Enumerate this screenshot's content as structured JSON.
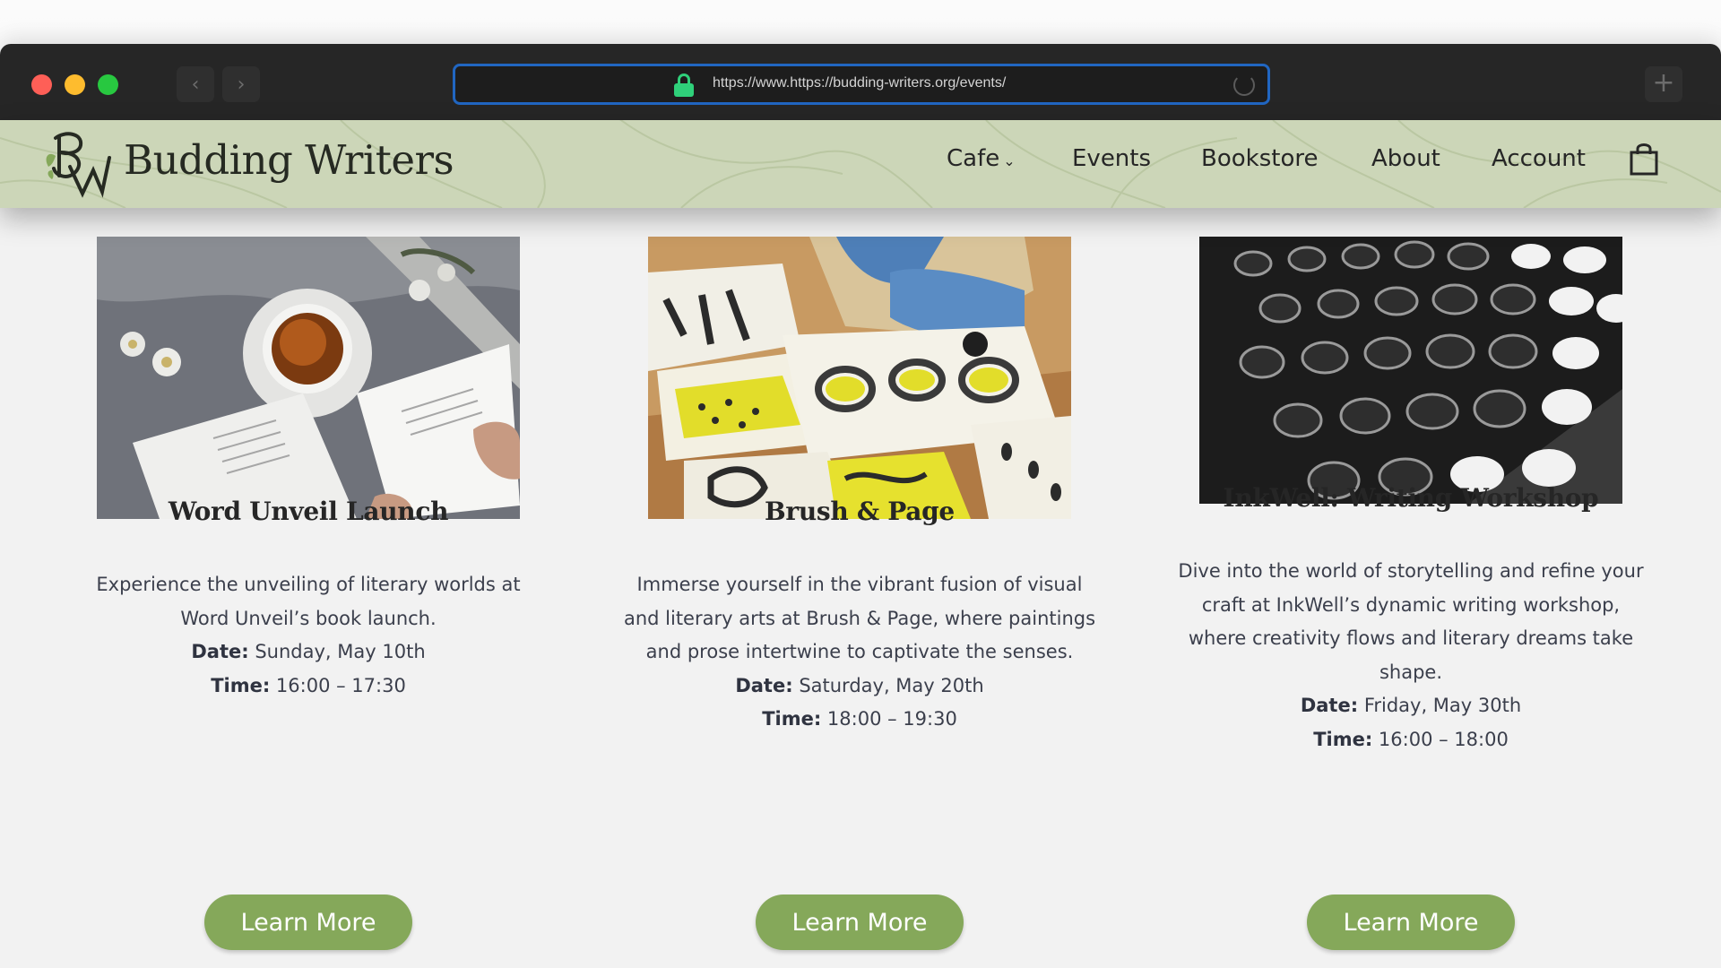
{
  "browser": {
    "url": "https://www.https://budding-writers.org/events/",
    "back_icon": "‹",
    "forward_icon": "›",
    "new_tab_icon": "+"
  },
  "site": {
    "title": "Budding Writers",
    "nav": [
      {
        "label": "Cafe",
        "has_dropdown": true
      },
      {
        "label": "Events"
      },
      {
        "label": "Bookstore"
      },
      {
        "label": "About"
      },
      {
        "label": "Account"
      }
    ],
    "dropdown_chevron": "⌄",
    "header_color": "#ccd6b8",
    "accent_color": "#85a85a"
  },
  "events": [
    {
      "title": "Word Unveil Launch",
      "description": "Experience the unveiling of literary worlds at Word Unveil’s book launch.",
      "date_label": "Date:",
      "date": "Sunday, May 10th",
      "time_label": "Time:",
      "time": "16:00 – 17:30",
      "button": "Learn More",
      "image_icon": "tea-and-book-photo"
    },
    {
      "title": "Brush & Page",
      "description": "Immerse yourself in the vibrant fusion of visual and literary arts at Brush & Page, where paintings and prose intertwine to captivate the senses.",
      "date_label": "Date:",
      "date": "Saturday, May 20th",
      "time_label": "Time:",
      "time": "18:00 – 19:30",
      "button": "Learn More",
      "image_icon": "painting-on-floor-photo"
    },
    {
      "title": "InkWell: Writing Workshop",
      "description": "Dive into the world of storytelling and refine your craft at InkWell’s dynamic writing workshop, where creativity flows and literary dreams take shape.",
      "date_label": "Date:",
      "date": "Friday, May 30th",
      "time_label": "Time:",
      "time": "16:00 – 18:00",
      "button": "Learn More",
      "image_icon": "typewriter-keys-photo"
    }
  ]
}
